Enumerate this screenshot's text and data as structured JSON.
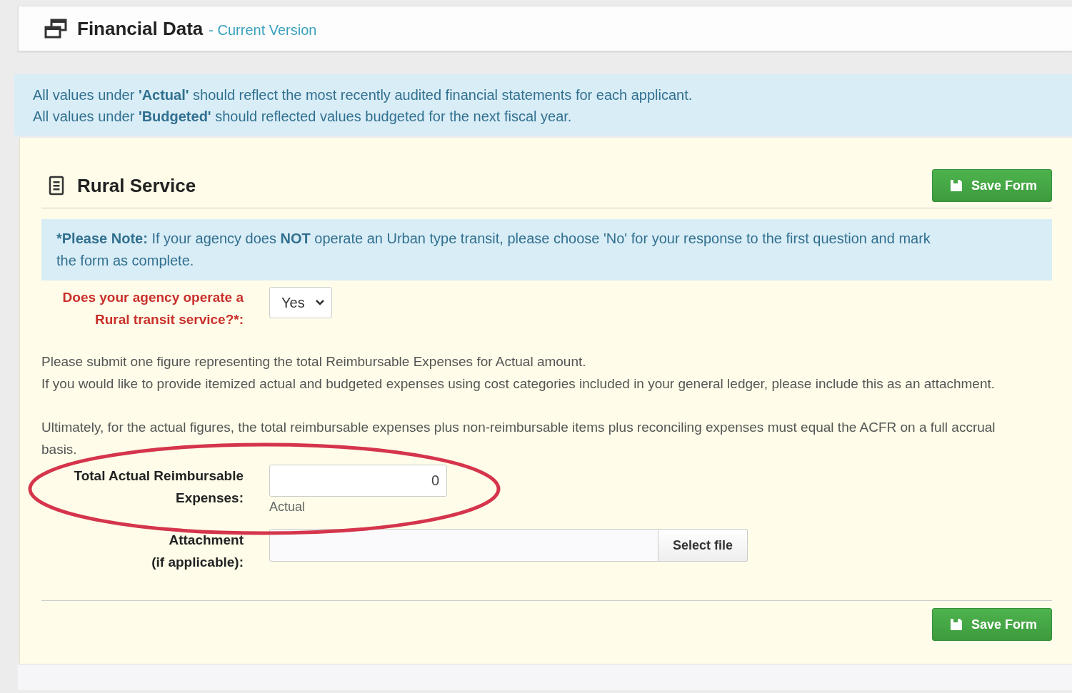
{
  "header": {
    "title": "Financial Data",
    "subtitle": "- Current Version"
  },
  "info": [
    "All values under **'Actual'** should reflect the most recently audited financial statements for each applicant.",
    "All values under **'Budgeted'** should reflected values budgeted for the next fiscal year."
  ],
  "section": {
    "title": "Rural Service",
    "save_button": "Save Form"
  },
  "note": "***Please Note:** If your agency does **NOT** operate an Urban type transit, please choose 'No' for your response to the first question and mark the form as complete.",
  "question": {
    "label": "Does your agency operate a Rural transit service?*:",
    "value": "Yes"
  },
  "instructions": [
    "Please submit one figure representing the total Reimbursable Expenses for Actual amount.",
    "If you would like to provide itemized actual and budgeted expenses using cost categories included in your general ledger, please include this as an attachment."
  ],
  "basis_note": "Ultimately, for the actual figures, the total reimbursable expenses plus non-reimbursable items plus reconciling expenses must equal the ACFR on a full accrual basis.",
  "total_field": {
    "label_lines": [
      "Total Actual Reimbursable",
      "Expenses:"
    ],
    "value": "0",
    "help": "Actual"
  },
  "attachment": {
    "label_lines": [
      "Attachment",
      "(if applicable):"
    ],
    "button": "Select file"
  },
  "footer": {
    "save_button": "Save Form"
  },
  "annotations": [
    {
      "kind": "ellipse"
    }
  ]
}
